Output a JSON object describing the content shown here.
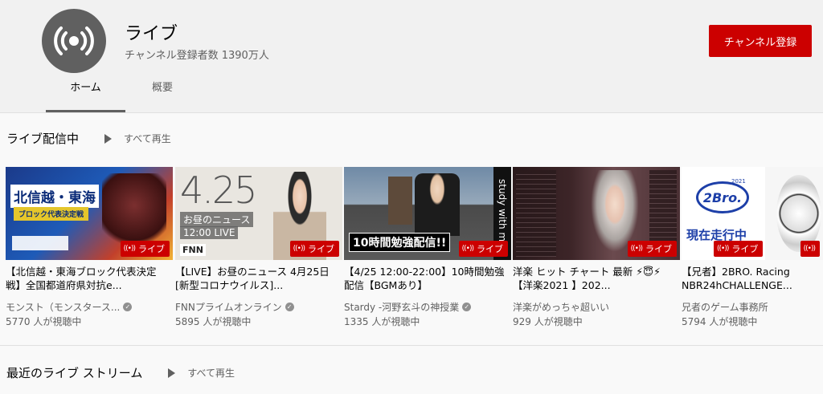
{
  "channel": {
    "name": "ライブ",
    "subscribers": "チャンネル登録者数 1390万人",
    "subscribe_label": "チャンネル登録",
    "avatar_icon": "live-broadcast-icon"
  },
  "tabs": [
    {
      "label": "ホーム",
      "active": true
    },
    {
      "label": "概要",
      "active": false
    }
  ],
  "sections": [
    {
      "title": "ライブ配信中",
      "play_all": "すべて再生"
    },
    {
      "title": "最近のライブ ストリーム",
      "play_all": "すべて再生"
    }
  ],
  "videos": [
    {
      "title": "【北信越・東海ブロック代表決定戦】全国都道府県対抗e...",
      "channel": "モンスト（モンスタース...",
      "verified": true,
      "views": "5770 人が視聴中",
      "badge": "ライブ",
      "thumb_text": [
        "北信越・東海",
        "ブロック代表決定戦"
      ]
    },
    {
      "title": "【LIVE】お昼のニュース 4月25日 [新型コロナウイルス]...",
      "channel": "FNNプライムオンライン",
      "verified": true,
      "views": "5895 人が視聴中",
      "badge": "ライブ",
      "thumb_text": [
        "4.25",
        "お昼のニュース",
        "12:00 LIVE",
        "FNN"
      ]
    },
    {
      "title": "【4/25 12:00-22:00】10時間勉強配信【BGMあり】",
      "channel": "Stardy -河野玄斗の神授業",
      "verified": true,
      "views": "1335 人が視聴中",
      "badge": "ライブ",
      "thumb_text": [
        "10時間勉強配信!!",
        "study with me"
      ]
    },
    {
      "title": "洋楽 ヒット チャート 最新 ⚡😇⚡ 【洋楽2021 】202...",
      "channel": "洋楽がめっちゃ超いい",
      "verified": false,
      "views": "929 人が視聴中",
      "badge": "ライブ",
      "thumb_text": []
    },
    {
      "title": "【兄者】2BRO. Racing NBR24hCHALLENGE...",
      "channel": "兄者のゲーム事務所",
      "verified": false,
      "views": "5794 人が視聴中",
      "badge": "ライブ",
      "thumb_text": [
        "2Bro.",
        "2021",
        "現在走行中"
      ]
    }
  ],
  "colors": {
    "brand_red": "#cc0000",
    "header_bg": "#f1f1f1",
    "page_bg": "#f9f9f9",
    "secondary_text": "#606060"
  }
}
